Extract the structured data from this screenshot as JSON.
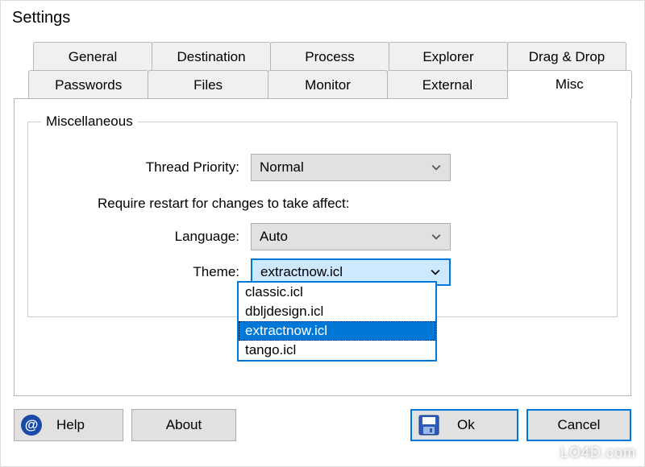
{
  "window": {
    "title": "Settings"
  },
  "tabs_row1": [
    {
      "label": "General"
    },
    {
      "label": "Destination"
    },
    {
      "label": "Process"
    },
    {
      "label": "Explorer"
    },
    {
      "label": "Drag & Drop"
    }
  ],
  "tabs_row2": [
    {
      "label": "Passwords"
    },
    {
      "label": "Files"
    },
    {
      "label": "Monitor"
    },
    {
      "label": "External"
    },
    {
      "label": "Misc",
      "active": true
    }
  ],
  "panel": {
    "group_title": "Miscellaneous",
    "thread_priority_label": "Thread Priority:",
    "thread_priority_value": "Normal",
    "restart_note": "Require restart for changes to take affect:",
    "language_label": "Language:",
    "language_value": "Auto",
    "theme_label": "Theme:",
    "theme_value": "extractnow.icl",
    "theme_options": [
      "classic.icl",
      "dbljdesign.icl",
      "extractnow.icl",
      "tango.icl"
    ],
    "theme_selected_index": 2
  },
  "buttons": {
    "help": "Help",
    "about": "About",
    "ok": "Ok",
    "cancel": "Cancel"
  },
  "watermark": "LO4D.com",
  "chart_data": null
}
